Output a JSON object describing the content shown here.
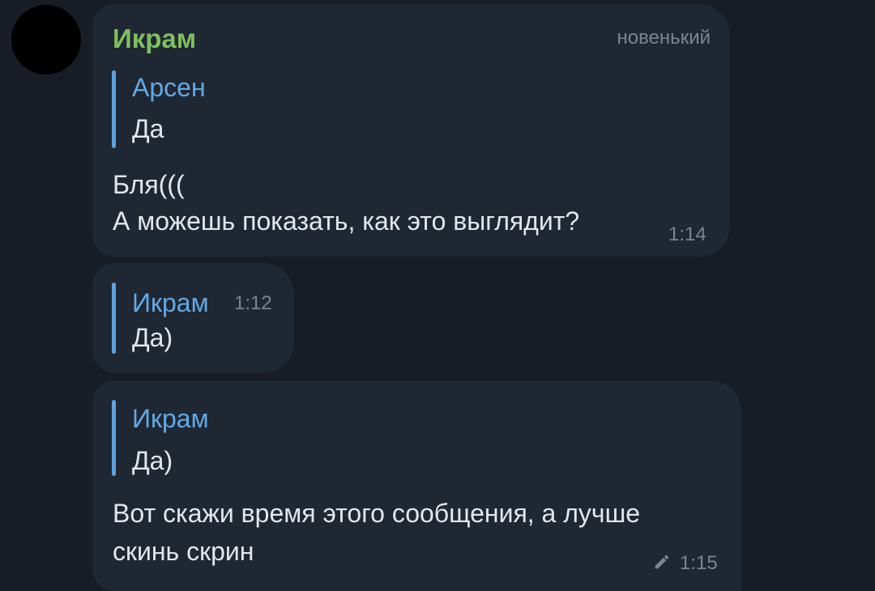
{
  "message1": {
    "sender": "Икрам",
    "role": "новенький",
    "reply": {
      "name": "Арсен",
      "text": "Да"
    },
    "lines": [
      "Бля(((",
      "А можешь показать, как это выглядит?"
    ],
    "time": "1:14"
  },
  "message2": {
    "reply": {
      "name": "Икрам",
      "time": "1:12",
      "text": "Да)"
    }
  },
  "message3": {
    "reply": {
      "name": "Икрам",
      "text": "Да)"
    },
    "lines": [
      "Вот скажи время этого сообщения, а лучше",
      "скинь скрин"
    ],
    "time": "1:15",
    "edited_icon": "pencil-icon"
  },
  "colors": {
    "background": "#181d25",
    "bubble": "#1f2733",
    "sender_name": "#7fbf5e",
    "reply_accent": "#5ea3dc",
    "meta": "#7a8592",
    "text": "#e3e7ec"
  }
}
